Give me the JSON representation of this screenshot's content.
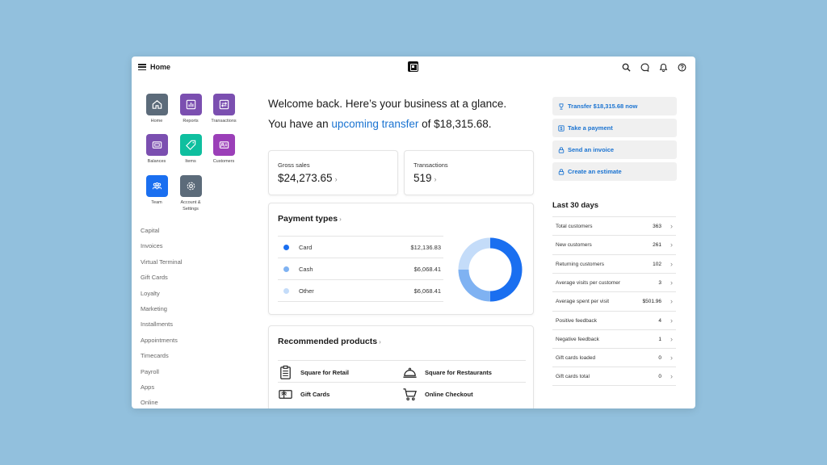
{
  "header": {
    "title": "Home",
    "icons": [
      "menu-icon",
      "square-logo",
      "search-icon",
      "chat-icon",
      "bell-icon",
      "help-icon"
    ]
  },
  "sidebar": {
    "tiles": [
      {
        "label": "Home",
        "icon": "home-icon",
        "color": "#5c6b7a"
      },
      {
        "label": "Reports",
        "icon": "bar-chart-icon",
        "color": "#7b4fb0"
      },
      {
        "label": "Transactions",
        "icon": "transfer-icon",
        "color": "#7b4fb0"
      },
      {
        "label": "Balances",
        "icon": "bank-card-icon",
        "color": "#7b4fb0"
      },
      {
        "label": "Items",
        "icon": "tag-icon",
        "color": "#0fbf9f"
      },
      {
        "label": "Customers",
        "icon": "contact-card-icon",
        "color": "#9b3fb8"
      },
      {
        "label": "Team",
        "icon": "team-icon",
        "color": "#1a6ff0"
      },
      {
        "label_line1": "Account &",
        "label_line2": "Settings",
        "icon": "gear-icon",
        "color": "#5c6b7a"
      }
    ],
    "links": [
      "Capital",
      "Invoices",
      "Virtual Terminal",
      "Gift Cards",
      "Loyalty",
      "Marketing",
      "Installments",
      "Appointments",
      "Timecards",
      "Payroll",
      "Apps",
      "Online"
    ]
  },
  "main": {
    "welcome": "Welcome back. Here’s your business at a glance.",
    "sub_prefix": "You have an ",
    "sub_link": "upcoming transfer",
    "sub_suffix": " of $18,315.68.",
    "gross_sales": {
      "label": "Gross sales",
      "value": "$24,273.65"
    },
    "transactions": {
      "label": "Transactions",
      "value": "519"
    },
    "payment_types": {
      "title": "Payment types",
      "rows": [
        {
          "label": "Card",
          "value": "$12,136.83",
          "color": "#1a6ff0"
        },
        {
          "label": "Cash",
          "value": "$6,068.41",
          "color": "#7fb2f2"
        },
        {
          "label": "Other",
          "value": "$6,068.41",
          "color": "#c4dcf9"
        }
      ]
    },
    "recommended": {
      "title": "Recommended products",
      "items": [
        {
          "label": "Square for Retail",
          "icon": "clipboard-icon"
        },
        {
          "label": "Square for Restaurants",
          "icon": "cloche-icon"
        },
        {
          "label": "Gift Cards",
          "icon": "gift-card-icon"
        },
        {
          "label": "Online Checkout",
          "icon": "cart-icon"
        }
      ]
    }
  },
  "right": {
    "actions": [
      {
        "label": "Transfer $18,315.68 now",
        "icon": "trophy-icon"
      },
      {
        "label": "Take a payment",
        "icon": "dollar-icon"
      },
      {
        "label": "Send an invoice",
        "icon": "lock-icon"
      },
      {
        "label": "Create an estimate",
        "icon": "lock-icon"
      }
    ],
    "stats_title": "Last 30 days",
    "stats": [
      {
        "label": "Total customers",
        "value": "363"
      },
      {
        "label": "New customers",
        "value": "261"
      },
      {
        "label": "Returning customers",
        "value": "102"
      },
      {
        "label": "Average visits per customer",
        "value": "3"
      },
      {
        "label": "Average spent per visit",
        "value": "$501.96"
      },
      {
        "label": "Positive feedback",
        "value": "4"
      },
      {
        "label": "Negative feedback",
        "value": "1"
      },
      {
        "label": "Gift cards loaded",
        "value": "0"
      },
      {
        "label": "Gift cards total",
        "value": "0"
      }
    ]
  }
}
